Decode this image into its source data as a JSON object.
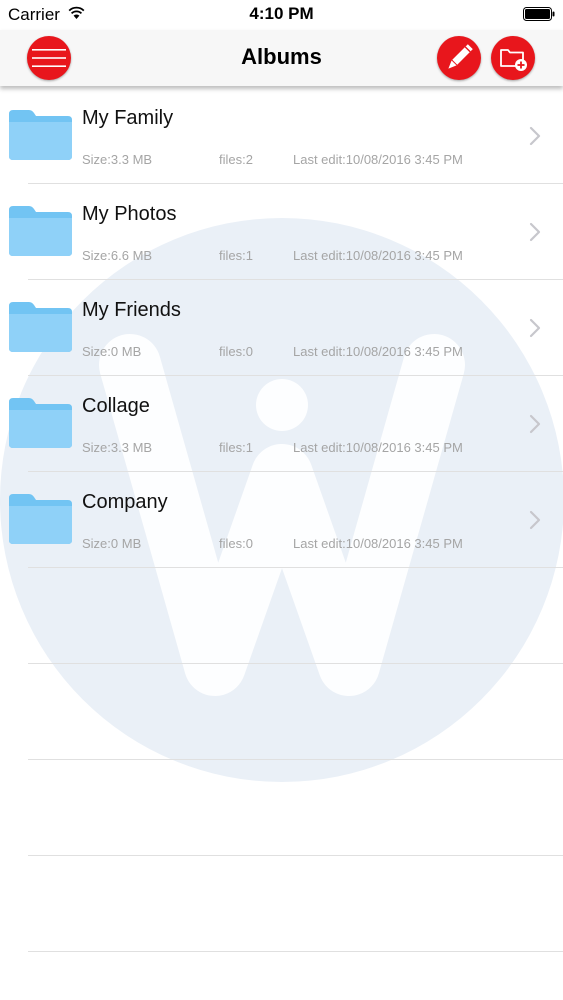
{
  "status": {
    "carrier": "Carrier",
    "time": "4:10 PM"
  },
  "nav": {
    "title": "Albums",
    "menu_icon": "hamburger-menu-icon",
    "edit_icon": "pencil-icon",
    "add_icon": "folder-add-icon",
    "accent_color": "#e8161c"
  },
  "albums": [
    {
      "name": "My Family",
      "size": "Size:3.3 MB",
      "files": "files:2",
      "edit": "Last edit:10/08/2016 3:45 PM"
    },
    {
      "name": "My Photos",
      "size": "Size:6.6 MB",
      "files": "files:1",
      "edit": "Last edit:10/08/2016 3:45 PM"
    },
    {
      "name": "My Friends",
      "size": "Size:0 MB",
      "files": "files:0",
      "edit": "Last edit:10/08/2016 3:45 PM"
    },
    {
      "name": "Collage",
      "size": "Size:3.3 MB",
      "files": "files:1",
      "edit": "Last edit:10/08/2016 3:45 PM"
    },
    {
      "name": "Company",
      "size": "Size:0 MB",
      "files": "files:0",
      "edit": "Last edit:10/08/2016 3:45 PM"
    }
  ],
  "folder_color": "#6ec6f5"
}
